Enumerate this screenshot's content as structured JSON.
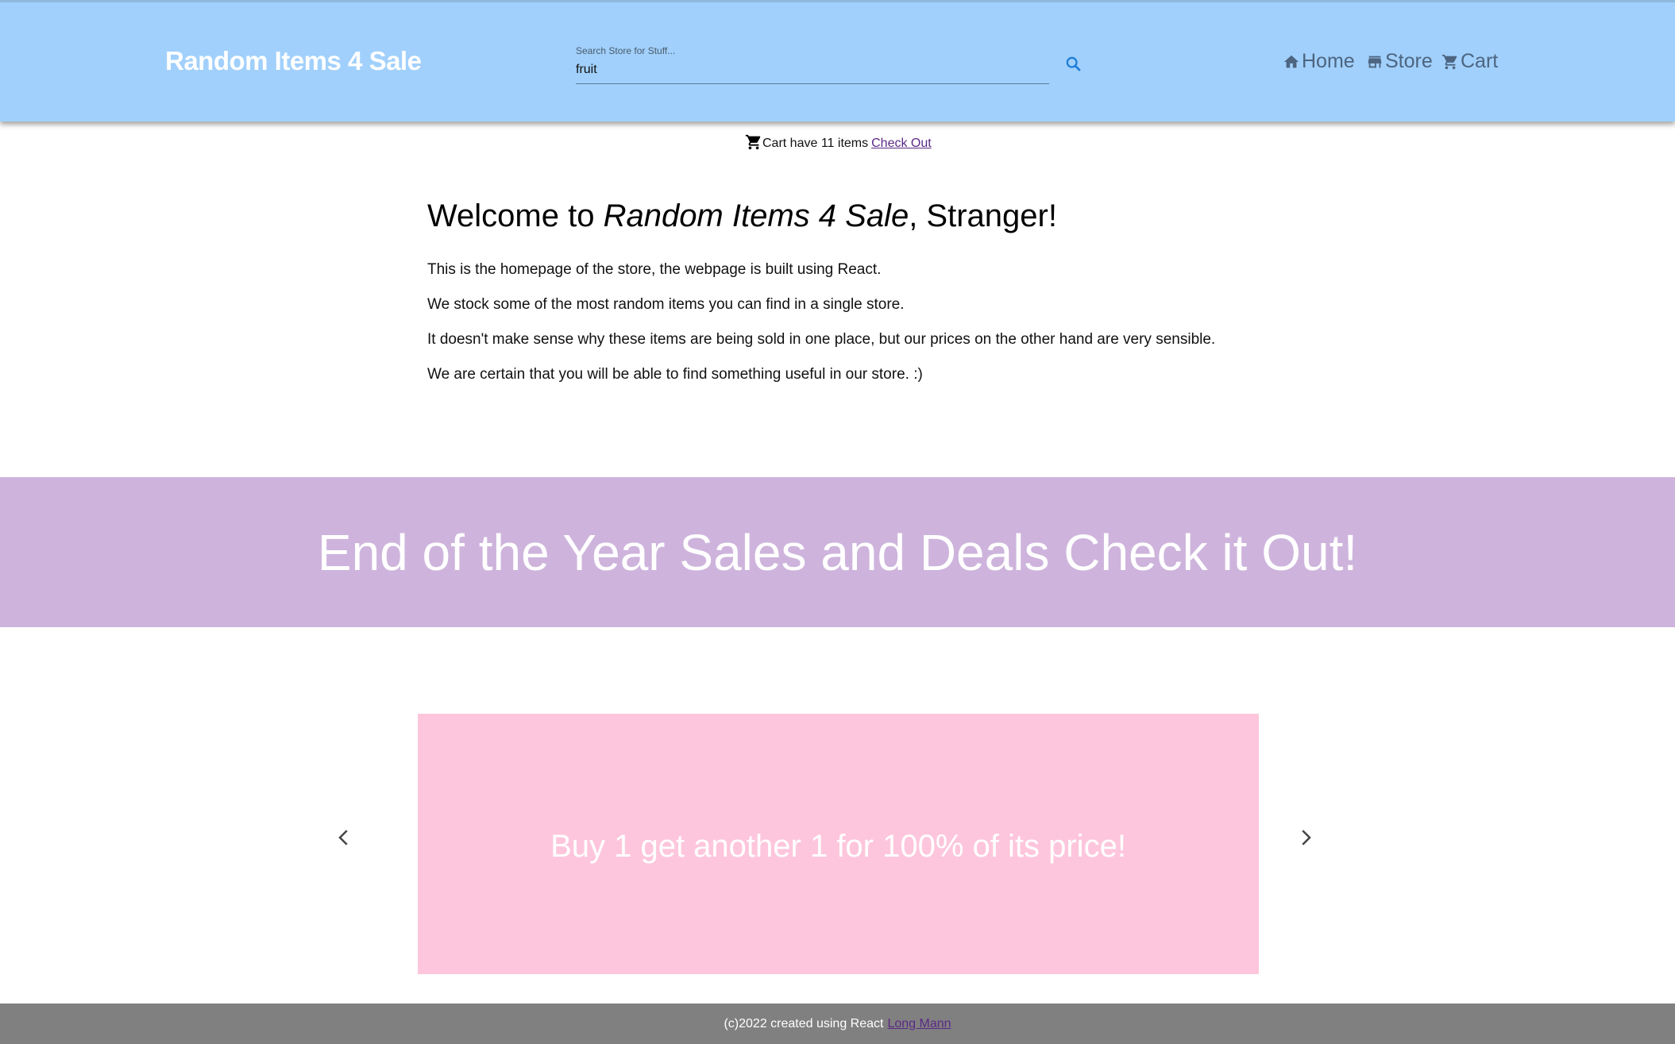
{
  "header": {
    "brand": "Random Items 4 Sale",
    "search": {
      "label": "Search Store for Stuff...",
      "value": "fruit"
    },
    "nav": [
      {
        "label": "Home",
        "icon": "home-icon"
      },
      {
        "label": "Store",
        "icon": "store-icon"
      },
      {
        "label": "Cart",
        "icon": "cart-icon"
      }
    ]
  },
  "cart_status": {
    "prefix": "Cart have",
    "count": "11",
    "suffix": "items",
    "link": "Check Out"
  },
  "welcome": {
    "title_prefix": "Welcome to ",
    "title_store": "Random Items 4 Sale",
    "title_suffix": ", Stranger!",
    "paragraphs": [
      "This is the homepage of the store, the webpage is built using React.",
      "We stock some of the most random items you can find in a single store.",
      "It doesn't make sense why these items are being sold in one place, but our prices on the other hand are very sensible.",
      "We are certain that you will be able to find something useful in our store. :)"
    ]
  },
  "banner": {
    "text": "End of the Year Sales and Deals Check it Out!"
  },
  "carousel": {
    "slide_text": "Buy 1 get another 1 for 100% of its price!"
  },
  "footer": {
    "text": "(c)2022 created using React",
    "link": "Long Mann"
  },
  "colors": {
    "header_bg": "#a1d0fc",
    "banner_bg": "#ceb4dc",
    "slide_bg": "#fec6dc",
    "footer_bg": "#808080",
    "nav_text": "#4d6580",
    "link": "#5b2a86"
  }
}
